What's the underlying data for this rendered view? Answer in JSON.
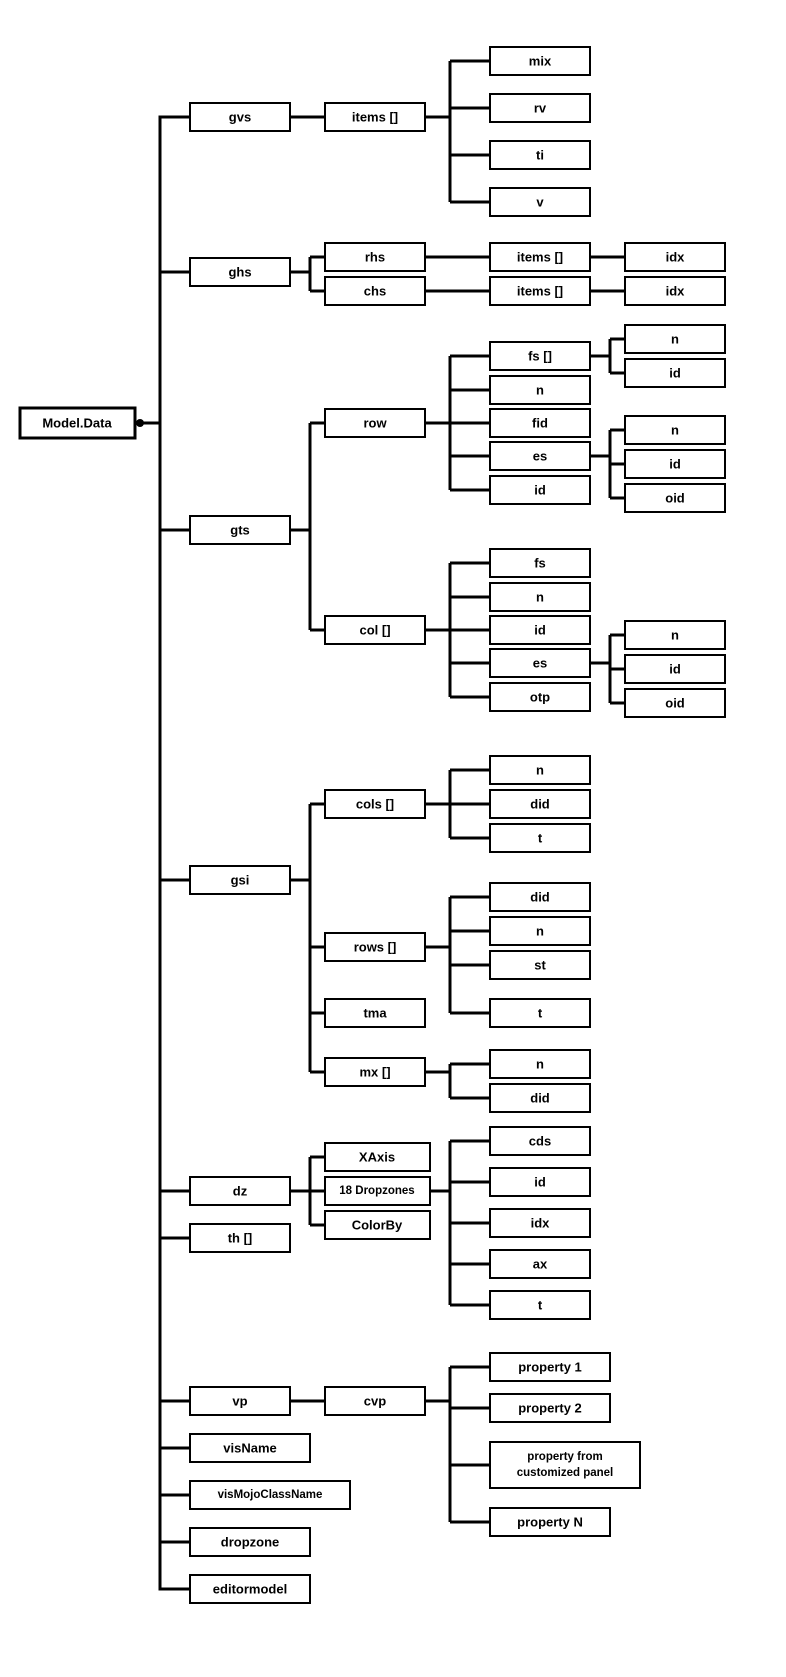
{
  "root": "Model.Data",
  "gvs": {
    "label": "gvs",
    "items": {
      "label": "items []",
      "children": [
        "mix",
        "rv",
        "ti",
        "v"
      ]
    }
  },
  "ghs": {
    "label": "ghs",
    "rhs": {
      "label": "rhs",
      "items": {
        "label": "items []",
        "idx": "idx"
      }
    },
    "chs": {
      "label": "chs",
      "items": {
        "label": "items []",
        "idx": "idx"
      }
    }
  },
  "gts": {
    "label": "gts",
    "row": {
      "label": "row",
      "children": [
        "fs []",
        "n",
        "fid",
        "es",
        "id"
      ],
      "fs": {
        "children": [
          "n",
          "id"
        ]
      },
      "es": {
        "children": [
          "n",
          "id",
          "oid"
        ]
      }
    },
    "col": {
      "label": "col []",
      "children": [
        "fs",
        "n",
        "id",
        "es",
        "otp"
      ],
      "es": {
        "children": [
          "n",
          "id",
          "oid"
        ]
      }
    }
  },
  "gsi": {
    "label": "gsi",
    "cols": {
      "label": "cols []",
      "children": [
        "n",
        "did",
        "t"
      ]
    },
    "rows": {
      "label": "rows []",
      "children": [
        "did",
        "n",
        "st",
        "t"
      ]
    },
    "tma": {
      "label": "tma"
    },
    "mx": {
      "label": "mx []",
      "children": [
        "n",
        "did"
      ]
    }
  },
  "dz": {
    "label": "dz",
    "children": [
      "XAxis",
      "18 Dropzones",
      "ColorBy"
    ],
    "props": [
      "cds",
      "id",
      "idx",
      "ax",
      "t"
    ]
  },
  "th": {
    "label": "th []"
  },
  "vp": {
    "label": "vp",
    "cvp": {
      "label": "cvp",
      "children": [
        "property 1",
        "property 2",
        "property from customized panel",
        "property N"
      ]
    }
  },
  "leaves": [
    "visName",
    "visMojoClassName",
    "dropzone",
    "editormodel"
  ]
}
